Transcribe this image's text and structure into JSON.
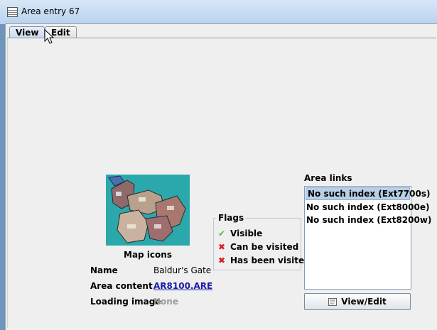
{
  "window": {
    "title": "Area entry 67"
  },
  "tabs": [
    {
      "label": "View",
      "active": true
    },
    {
      "label": "Edit",
      "active": false
    }
  ],
  "map": {
    "label": "Map icons"
  },
  "properties": {
    "name_label": "Name",
    "name_value": "Baldur's Gate",
    "content_label": "Area content",
    "content_value": "AR8100.ARE",
    "loading_label": "Loading image",
    "loading_value": "None"
  },
  "flags": {
    "title": "Flags",
    "items": [
      {
        "label": "Visible",
        "checked": true,
        "icon": "check-icon"
      },
      {
        "label": "Can be visited",
        "checked": false,
        "icon": "cross-icon"
      },
      {
        "label": "Has been visited",
        "checked": false,
        "icon": "cross-icon"
      }
    ]
  },
  "area_links": {
    "label": "Area links",
    "items": [
      "No such index (Ext7700s)",
      "No such index (Ext8000e)",
      "No such index (Ext8200w)"
    ],
    "selected_index": 0
  },
  "buttons": {
    "view_edit": "View/Edit"
  },
  "colors": {
    "map_bg": "#2aa8ab",
    "link": "#1a1aa8",
    "selection": "#b8cfe5"
  }
}
